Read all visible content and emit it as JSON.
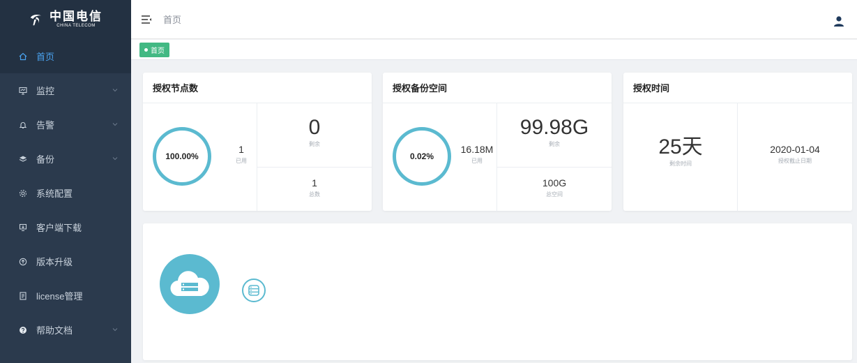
{
  "brand": {
    "cn": "中国电信",
    "en": "CHINA TELECOM"
  },
  "sidebar": {
    "items": [
      {
        "label": "首页",
        "icon": "home-icon",
        "active": true,
        "has_children": false
      },
      {
        "label": "监控",
        "icon": "monitor-icon",
        "active": false,
        "has_children": true
      },
      {
        "label": "告警",
        "icon": "bell-icon",
        "active": false,
        "has_children": true
      },
      {
        "label": "备份",
        "icon": "layers-icon",
        "active": false,
        "has_children": true
      },
      {
        "label": "系统配置",
        "icon": "gear-icon",
        "active": false,
        "has_children": false
      },
      {
        "label": "客户端下载",
        "icon": "download-icon",
        "active": false,
        "has_children": false
      },
      {
        "label": "版本升级",
        "icon": "upgrade-icon",
        "active": false,
        "has_children": false
      },
      {
        "label": "license管理",
        "icon": "license-icon",
        "active": false,
        "has_children": false
      },
      {
        "label": "帮助文档",
        "icon": "help-icon",
        "active": false,
        "has_children": true
      }
    ]
  },
  "header": {
    "breadcrumb": "首页"
  },
  "tags": {
    "current": "首页"
  },
  "cards": {
    "nodes": {
      "title": "授权节点数",
      "percent": "100.00%",
      "used_value": "1",
      "used_label": "已用",
      "remain_value": "0",
      "remain_label": "剩余",
      "total_value": "1",
      "total_label": "总数"
    },
    "backup": {
      "title": "授权备份空间",
      "percent": "0.02%",
      "used_value": "16.18M",
      "used_label": "已用",
      "remain_value": "99.98G",
      "remain_label": "剩余",
      "total_value": "100G",
      "total_label": "总空间"
    },
    "time": {
      "title": "授权时间",
      "remain_value": "25天",
      "remain_label": "剩余时间",
      "deadline_value": "2020-01-04",
      "deadline_label": "授权截止日期"
    }
  },
  "colors": {
    "accent": "#5bbad0",
    "danger": "#f04848",
    "active_nav": "#4aa3f0",
    "tag": "#42b983",
    "sidebar": "#2b3a4d"
  }
}
